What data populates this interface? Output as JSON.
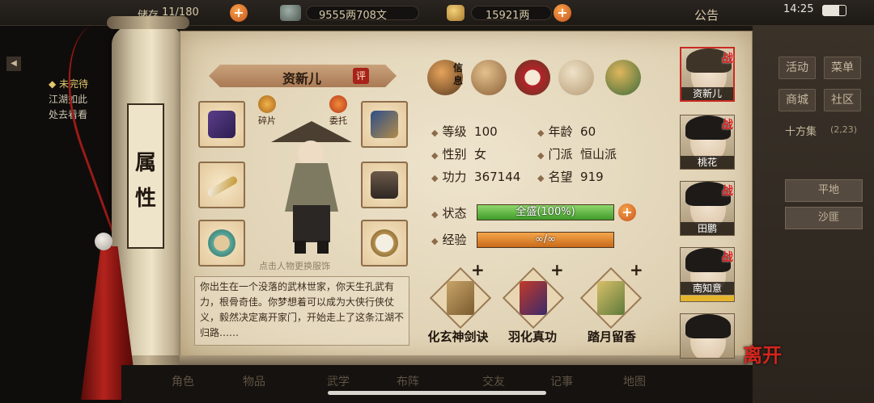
{
  "top_bar": {
    "bag_label": "储存",
    "bag_count": "11/180",
    "coins": "9555两708文",
    "silver": "15921两",
    "notice": "公告",
    "time": "14:25"
  },
  "left_notice": {
    "title": "◆ 未完待",
    "line1": "江湖如此",
    "line2": "处去看看"
  },
  "right_panel": {
    "buttons": [
      "活动",
      "菜单",
      "商城",
      "社区"
    ],
    "location": "十方集",
    "location_coord": "(2,23)",
    "map_buttons": [
      "平地",
      "沙匪"
    ]
  },
  "scroll": {
    "label": "属性"
  },
  "character": {
    "name": "资新儿",
    "review": "评",
    "fragments_label": "碎片",
    "entrust_label": "委托",
    "hint": "点击人物更换服饰",
    "bio": "你出生在一个没落的武林世家，你天生孔武有力，根骨奇佳。你梦想着可以成为大侠行侠仗义，毅然决定离开家门，开始走上了这条江湖不归路……"
  },
  "tabs": [
    {
      "name": "信息",
      "label": "信息",
      "active": true
    },
    {
      "name": "map",
      "label": ""
    },
    {
      "name": "bagua",
      "label": ""
    },
    {
      "name": "meridian",
      "label": ""
    },
    {
      "name": "inner-skill",
      "label": ""
    }
  ],
  "stats": {
    "level_label": "等级",
    "level": "100",
    "age_label": "年龄",
    "age": "60",
    "gender_label": "性别",
    "gender": "女",
    "sect_label": "门派",
    "sect": "恒山派",
    "power_label": "功力",
    "power": "367144",
    "fame_label": "名望",
    "fame": "919",
    "status_label": "状态",
    "status_text": "全盛(100%)",
    "status_fraction": 1.0,
    "exp_label": "经验",
    "exp_text": "∞/∞",
    "exp_fraction": 1.0
  },
  "skills": [
    {
      "name": "化玄神剑诀",
      "plus": "+"
    },
    {
      "name": "羽化真功",
      "plus": "+"
    },
    {
      "name": "踏月留香",
      "plus": "+"
    }
  ],
  "roster": [
    {
      "name": "资新儿",
      "tag": "战",
      "selected": true
    },
    {
      "name": "桃花",
      "tag": "战"
    },
    {
      "name": "田鹏",
      "tag": "战"
    },
    {
      "name": "南知意",
      "tag": "战"
    },
    {
      "name": "",
      "tag": ""
    }
  ],
  "leave_label": "离开",
  "bottom_nav": [
    "角色",
    "物品",
    "武学",
    "布阵",
    "交友",
    "记事",
    "地图"
  ],
  "colors": {
    "status_bar": "#5fb83a",
    "exp_bar": "#e58a2a",
    "accent_red": "#c92a22",
    "paper": "#e6d9bd"
  }
}
